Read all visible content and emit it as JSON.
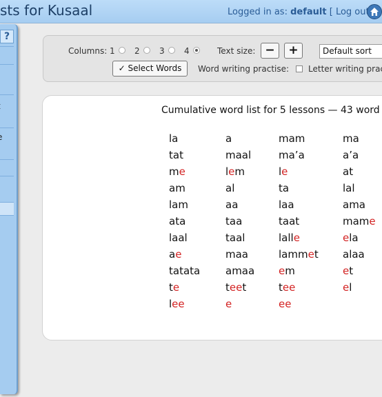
{
  "header": {
    "title": "sts for Kusaal",
    "logged_in_label": "Logged in as:",
    "username": "default",
    "logout_label": "[ Log out ]"
  },
  "sidebar": {
    "help_label": "?",
    "fragments": [
      "t",
      "e"
    ]
  },
  "controls": {
    "columns_label": "Columns:",
    "column_options": [
      "1",
      "2",
      "3",
      "4"
    ],
    "selected_columns": "4",
    "text_size_label": "Text size:",
    "decrease_label": "−",
    "increase_label": "+",
    "sort_value": "Default sort",
    "select_words_label": "✓ Select Words",
    "word_writing_label": "Word writing practise:",
    "letter_writing_label": "Letter writing prac"
  },
  "wordlist": {
    "title": "Cumulative word list for 5 lessons — 43 word",
    "highlight_color": "#d32222",
    "columns": [
      [
        "la",
        "tat",
        "m|e|",
        "am",
        "lam",
        "ata",
        "laal",
        "a|e|",
        "tatata",
        "t|e|",
        "l|ee|"
      ],
      [
        "a",
        "maal",
        "l|e|m",
        "al",
        "aa",
        "taa",
        "taal",
        "maa",
        "amaa",
        "t|ee|t",
        "|e|"
      ],
      [
        "mam",
        "ma’a",
        "l|e|",
        "ta",
        "laa",
        "taat",
        "lall|e|",
        "lamm|e|t",
        "|e|m",
        "t|ee|",
        "|ee|"
      ],
      [
        "ma",
        "a’a",
        "at",
        "lal",
        "ama",
        "mam|e|",
        "|e|la",
        "alaa",
        "|e|t",
        "|e|l"
      ]
    ]
  }
}
